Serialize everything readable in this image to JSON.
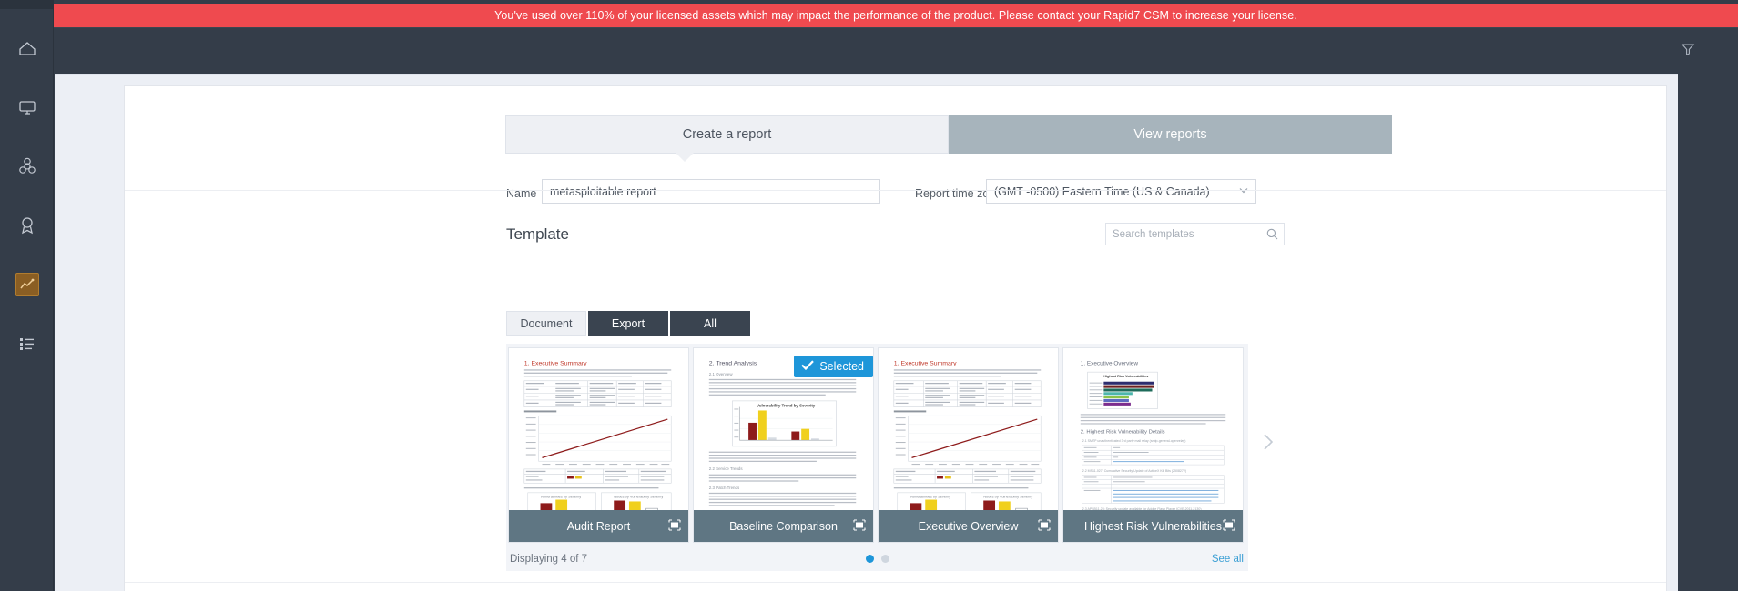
{
  "banner": {
    "message": "You've used over 110% of your licensed assets which may impact the performance of the product. Please contact your Rapid7 CSM to increase your license.",
    "color": "#ef4a4f"
  },
  "sidebar": {
    "items": [
      {
        "icon": "home-icon",
        "label": "Home",
        "active": false
      },
      {
        "icon": "monitor-icon",
        "label": "Assets",
        "active": false
      },
      {
        "icon": "biohazard-icon",
        "label": "Vulnerabilities",
        "active": false
      },
      {
        "icon": "award-icon",
        "label": "Policies",
        "active": false
      },
      {
        "icon": "chart-icon",
        "label": "Reports",
        "active": true
      },
      {
        "icon": "list-icon",
        "label": "Administration",
        "active": false
      }
    ],
    "active_accent": "#8a5e23"
  },
  "toolbar": {
    "filter_icon": "filter-funnel-icon"
  },
  "tabs": [
    {
      "label": "Create a report",
      "active": true
    },
    {
      "label": "View reports",
      "active": false
    }
  ],
  "form": {
    "name_label": "Name",
    "name_value": "metasploitable report",
    "name_placeholder": "",
    "timezone_label": "Report time zone",
    "timezone_value": "(GMT -0500) Eastern Time (US & Canada)",
    "timezone_chevron": "chevron-down-icon"
  },
  "template": {
    "heading": "Template",
    "search_placeholder": "Search templates",
    "search_value": "",
    "search_icon": "search-icon",
    "filters": [
      {
        "label": "Document",
        "selected": false,
        "style": "light"
      },
      {
        "label": "Export",
        "selected": false,
        "style": "dark"
      },
      {
        "label": "All",
        "selected": false,
        "style": "dark"
      }
    ],
    "cards": [
      {
        "title": "Audit Report",
        "selected": false,
        "expand_icon": "expand-icon",
        "preview": "exec-summary"
      },
      {
        "title": "Baseline Comparison",
        "selected": true,
        "expand_icon": "expand-icon",
        "preview": "trend-analysis"
      },
      {
        "title": "Executive Overview",
        "selected": false,
        "expand_icon": "expand-icon",
        "preview": "exec-summary"
      },
      {
        "title": "Highest Risk Vulnerabilities",
        "selected": false,
        "expand_icon": "expand-icon",
        "preview": "highest-risk"
      }
    ],
    "selected_badge_label": "Selected",
    "selected_badge_icon": "check-icon",
    "next_arrow_icon": "chevron-right-icon",
    "footer": {
      "displaying": "Displaying 4 of 7",
      "see_all": "See all",
      "dots": [
        {
          "active": true
        },
        {
          "active": false
        }
      ]
    }
  }
}
